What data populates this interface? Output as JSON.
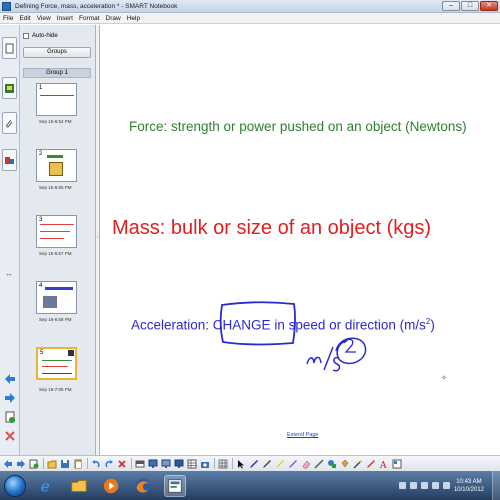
{
  "window": {
    "title": "Defining Force, mass, acceleration * - SMART Notebook",
    "minimize": "–",
    "maximize": "□",
    "close": "✕"
  },
  "menu": [
    "File",
    "Edit",
    "View",
    "Insert",
    "Format",
    "Draw",
    "Help"
  ],
  "sidebar": {
    "autohide_label": "Auto-hide",
    "groups_button": "Groups",
    "group_name": "Group 1",
    "thumbnails": [
      {
        "number": "1",
        "time": "Sep 16-6:54 PM"
      },
      {
        "number": "2",
        "time": "Sep 16-6:55 PM"
      },
      {
        "number": "3",
        "time": "Sep 16-6:57 PM"
      },
      {
        "number": "4",
        "time": "Sep 16-6:58 PM"
      },
      {
        "number": "5",
        "time": "Sep 16-7:05 PM"
      }
    ]
  },
  "canvas": {
    "force_text": "Force: strength or power pushed on an object (Newtons)",
    "mass_text": "Mass: bulk or size of an object (kgs)",
    "accel_prefix": "Acceleration: ",
    "accel_highlight": "CHANGE",
    "accel_rest": " in speed or direction (m/s",
    "accel_sup": "2",
    "accel_close": ")",
    "extend_page": "Extend Page",
    "colors": {
      "force": "#2f7f2f",
      "mass": "#e02020",
      "acceleration": "#2a2ad0"
    }
  },
  "taskbar": {
    "time": "10:43 AM",
    "date": "10/10/2012"
  }
}
